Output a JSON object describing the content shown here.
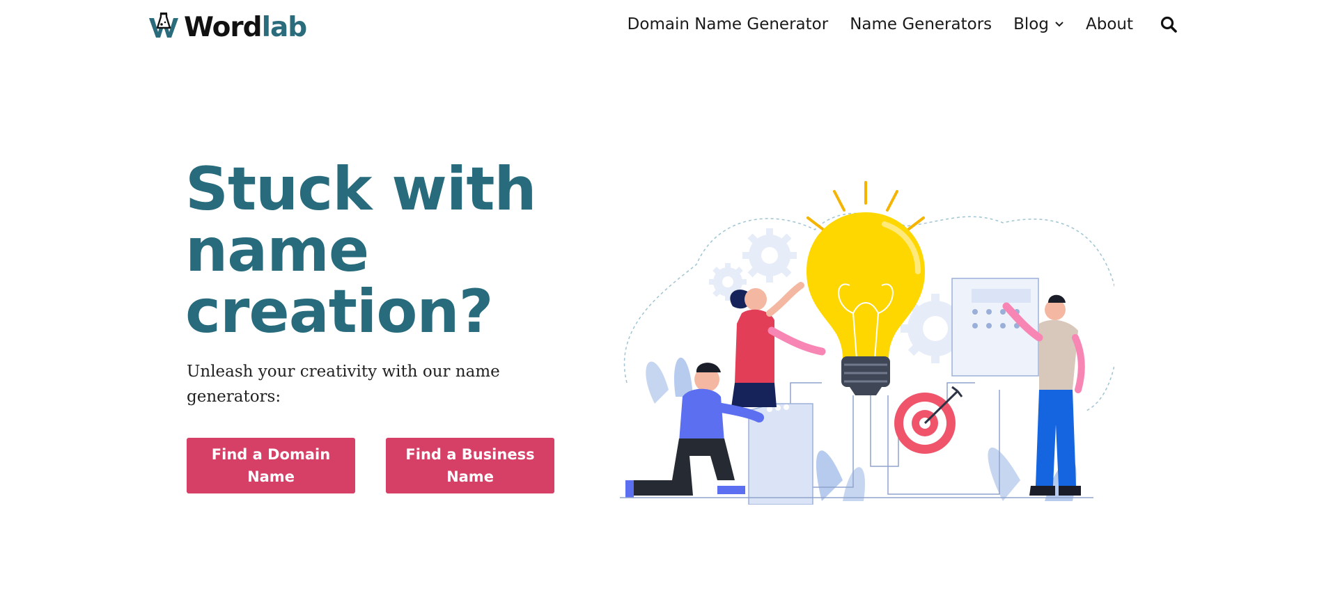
{
  "header": {
    "logo": {
      "word1": "Word",
      "word2": "lab"
    },
    "nav": [
      {
        "label": "Domain Name Generator"
      },
      {
        "label": "Name Generators"
      },
      {
        "label": "Blog"
      },
      {
        "label": "About"
      }
    ]
  },
  "hero": {
    "title": "Stuck with name creation?",
    "subtitle": "Unleash your creativity with our name generators:",
    "buttons": [
      {
        "label": "Find a Domain Name"
      },
      {
        "label": "Find a Business Name"
      }
    ]
  },
  "icons": {
    "logo": "flask-w-logo-icon",
    "blog_dropdown": "chevron-down-icon",
    "search": "search-icon",
    "illustration": "team-lightbulb-illustration"
  },
  "colors": {
    "brand_teal": "#276b7c",
    "button_pink": "#d63f66",
    "text_dark": "#1a1a1a",
    "bulb_yellow": "#ffd700",
    "accent_blue": "#5a6cf0"
  }
}
